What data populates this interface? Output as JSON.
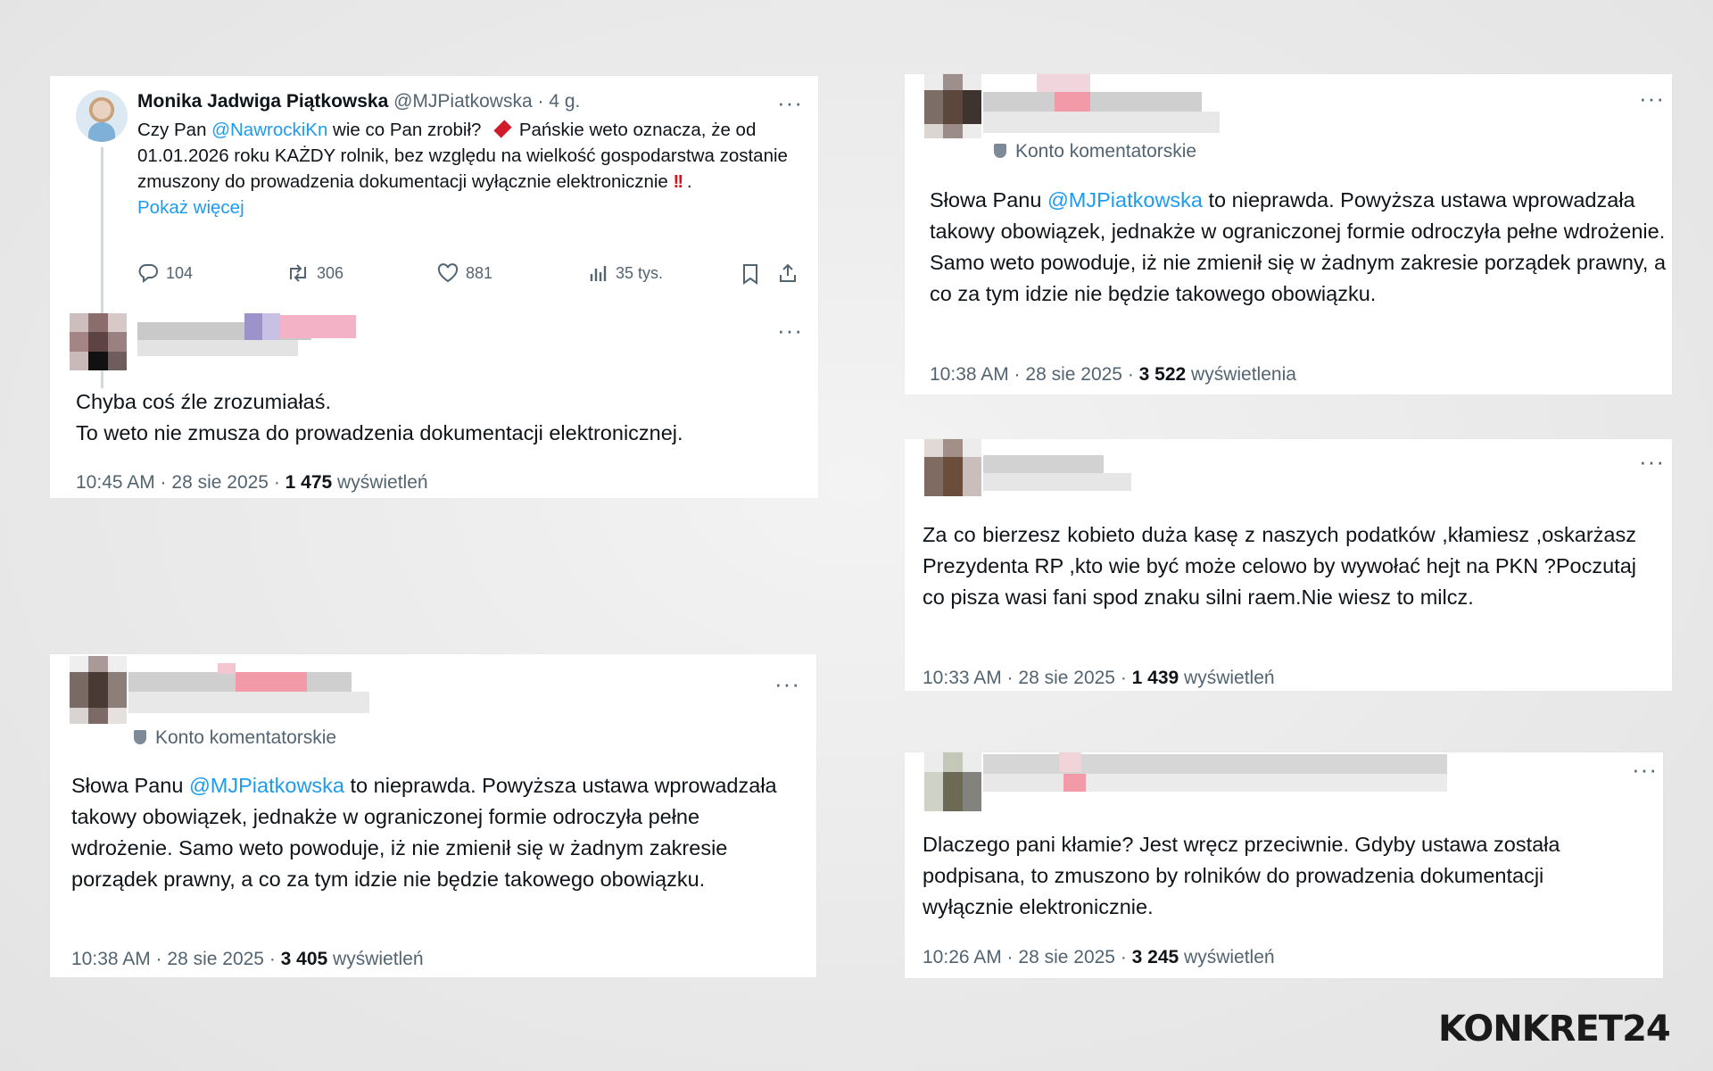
{
  "post": {
    "author": "Monika Jadwiga Piątkowska",
    "handle": "@MJPiatkowska",
    "age": "· 4 g.",
    "text_1": "Czy Pan ",
    "mention": "@NawrockiKn",
    "text_2": " wie co Pan zrobił? ",
    "text_3": " Pańskie weto oznacza, że od 01.01.2026 roku KAŻDY rolnik, bez względu na wielkość gospodarstwa zostanie zmuszony do prowadzenia dokumentacji wyłącznie elektronicznie ",
    "text_4": " .",
    "show_more": "Pokaż więcej",
    "replies": "104",
    "reposts": "306",
    "likes": "881",
    "views": "35 tys."
  },
  "reply_top_left": {
    "line1": "Chyba coś źle zrozumiałaś.",
    "line2": "To weto nie zmusza do prowadzenia dokumentacji elektronicznej.",
    "time": "10:45 AM · 28 sie 2025 · ",
    "views": "1 475",
    "views_label": " wyświetleń"
  },
  "reply_bottom_left": {
    "badge": "Konto komentatorskie",
    "text_1": "Słowa Panu ",
    "mention": "@MJPiatkowska",
    "text_2": " to nieprawda. Powyższa ustawa wprowadzała takowy obowiązek, jednakże w ograniczonej formie odroczyła pełne wdrożenie. Samo weto powoduje, iż nie zmienił się w żadnym zakresie porządek prawny, a co za tym idzie nie będzie takowego obowiązku.",
    "time": "10:38 AM · 28 sie 2025 · ",
    "views": "3 405",
    "views_label": " wyświetleń"
  },
  "reply_top_right": {
    "badge": "Konto komentatorskie",
    "text_1": "Słowa Panu ",
    "mention": "@MJPiatkowska",
    "text_2": " to nieprawda. Powyższa ustawa wprowadzała takowy obowiązek, jednakże w ograniczonej formie odroczyła pełne wdrożenie. Samo weto powoduje, iż nie zmienił się w żadnym zakresie porządek prawny, a co za tym idzie nie będzie takowego obowiązku.",
    "time": "10:38 AM · 28 sie 2025 · ",
    "views": "3 522",
    "views_label": " wyświetlenia"
  },
  "reply_mid_right": {
    "text": "Za co bierzesz kobieto duża kasę z naszych podatków ,kłamiesz ,oskarżasz Prezydenta RP ,kto wie być może celowo  by  wywołać  hejt na PKN ?Poczutaj  co  pisza  wasi  fani  spod  znaku  silni  raem.Nie wiesz  to milcz.",
    "time": "10:33 AM · 28 sie 2025 · ",
    "views": "1 439",
    "views_label": " wyświetleń"
  },
  "reply_bottom_right": {
    "text": "Dlaczego pani kłamie? Jest wręcz przeciwnie. Gdyby ustawa została podpisana, to zmuszono by rolników do prowadzenia dokumentacji wyłącznie elektronicznie.",
    "time": "10:26 AM · 28 sie 2025 · ",
    "views": "3 245",
    "views_label": " wyświetleń"
  },
  "more_label": "···",
  "brand": {
    "name": "KONKRET24"
  },
  "colors": {
    "link": "#1d9bf0",
    "text": "#0f1419",
    "muted": "#536471"
  }
}
